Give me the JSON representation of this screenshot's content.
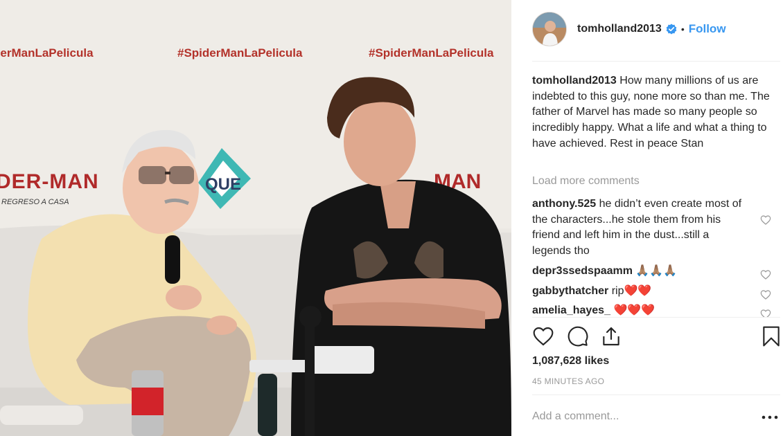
{
  "post_header": {
    "username": "tomholland2013",
    "separator": "•",
    "follow_label": "Follow"
  },
  "photo_backdrop": {
    "hashtag": "#SpiderManLaPelicula",
    "hashtag_partial": "derManLaPelicula",
    "logo_text": "DER-MAN",
    "logo_text_right": "MAN",
    "logo_sub": "REGRESO A CASA",
    "badge_text": "QUE"
  },
  "caption": {
    "username": "tomholland2013",
    "text": "How many millions of us are indebted to this guy, none more so than me. The father of Marvel has made so many people so incredibly happy. What a life and what a thing to have achieved. Rest in peace Stan"
  },
  "load_more_label": "Load more comments",
  "comments": [
    {
      "username": "anthony.525",
      "text": "he didn’t even create most of the characters...he stole them from his friend and left him in the dust...still a legends tho"
    },
    {
      "username": "depr3ssedspaamm",
      "text": "🙏🏽🙏🏽🙏🏽"
    },
    {
      "username": "gabbythatcher",
      "text": "rip❤️❤️"
    },
    {
      "username": "amelia_hayes_",
      "text": "❤️❤️❤️"
    }
  ],
  "likes_text": "1,087,628 likes",
  "timestamp": "45 MINUTES AGO",
  "add_comment_placeholder": "Add a comment...",
  "icons": {
    "like": "heart-icon",
    "comment": "comment-icon",
    "share": "share-icon",
    "save": "bookmark-icon",
    "verified": "verified-badge-icon",
    "more": "more-options-icon"
  },
  "colors": {
    "link_blue": "#3897f0",
    "text": "#262626",
    "muted": "#999999",
    "divider": "#efefef",
    "hashtag_red": "#b3322a"
  }
}
